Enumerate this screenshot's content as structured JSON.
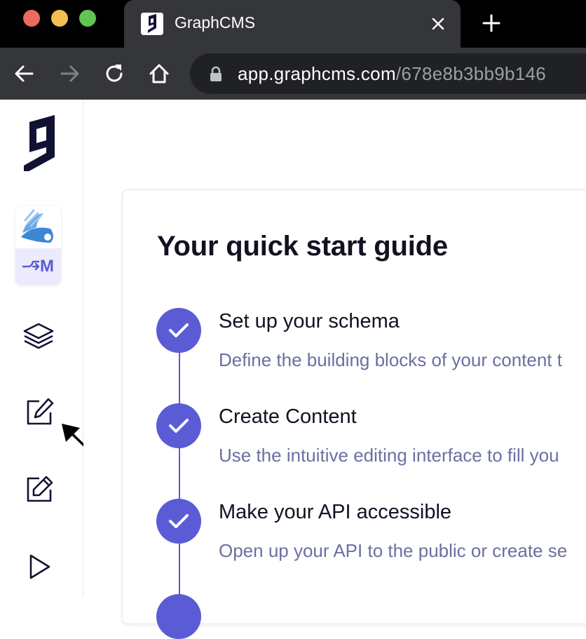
{
  "browser": {
    "tab": {
      "title": "GraphCMS"
    },
    "address": {
      "host": "app.graphcms.com",
      "path": "/678e8b3bb9b146"
    }
  },
  "colors": {
    "accent": "#5b5bd6",
    "tab_bg": "#35363a",
    "text_dark": "#111122",
    "text_muted": "#6b70a0"
  },
  "sidebar": {
    "logo": "graphcms-logo-icon",
    "project": {
      "env_label": "M",
      "env_icon": "git-branch-icon"
    },
    "items": [
      {
        "name": "schema",
        "icon": "layers-icon"
      },
      {
        "name": "content",
        "icon": "edit-icon"
      },
      {
        "name": "content-editing",
        "icon": "pencil-square-icon"
      },
      {
        "name": "api-playground",
        "icon": "play-icon"
      }
    ]
  },
  "main": {
    "guide": {
      "title": "Your quick start guide",
      "steps": [
        {
          "title": "Set up your schema",
          "desc": "Define the building blocks of your content t",
          "done": true
        },
        {
          "title": "Create Content",
          "desc": "Use the intuitive editing interface to fill you",
          "done": true
        },
        {
          "title": "Make your API accessible",
          "desc": "Open up your API to the public or create se",
          "done": true
        }
      ]
    }
  }
}
